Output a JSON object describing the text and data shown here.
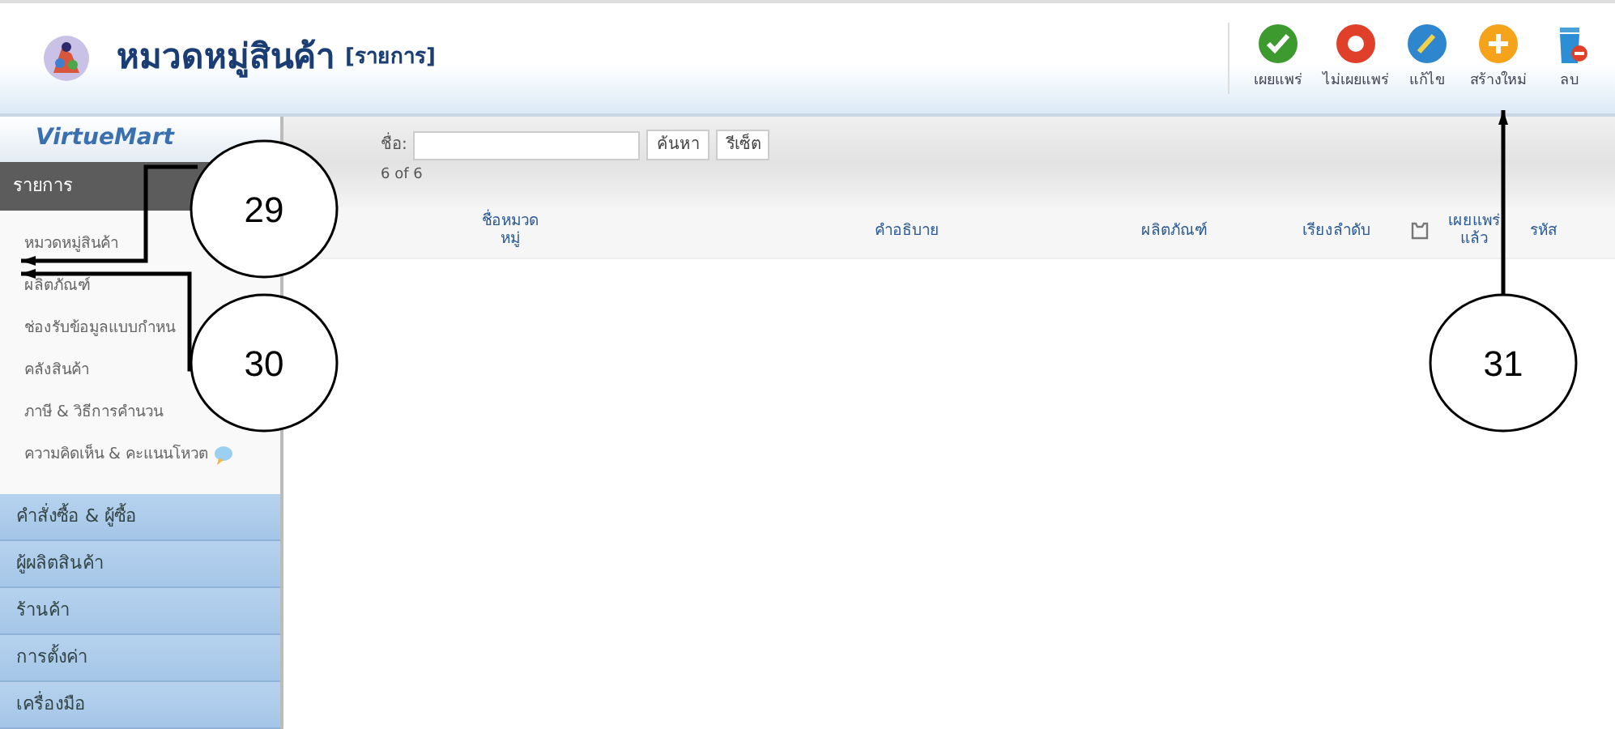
{
  "header": {
    "title": "หมวดหมู่สินค้า",
    "subtitle": "[รายการ]"
  },
  "toolbar": [
    {
      "kind": "publish",
      "label": "เผยแพร่"
    },
    {
      "kind": "unpublish",
      "label": "ไม่เผยแพร่"
    },
    {
      "kind": "edit",
      "label": "แก้ไข"
    },
    {
      "kind": "new",
      "label": "สร้างใหม่"
    },
    {
      "kind": "delete",
      "label": "ลบ"
    }
  ],
  "sidebar": {
    "logo": "VirtueMart",
    "section": "รายการ",
    "items": [
      {
        "label": "หมวดหมู่สินค้า",
        "icon": false
      },
      {
        "label": "ผลิตภัณฑ์",
        "icon": false
      },
      {
        "label": "ช่องรับข้อมูลแบบกำหน",
        "icon": false
      },
      {
        "label": "คลังสินค้า",
        "icon": false
      },
      {
        "label": "ภาษี & วิธีการคำนวน",
        "icon": false
      },
      {
        "label": "ความคิดเห็น & คะแนนโหวต",
        "icon": true
      }
    ],
    "groups": [
      "คำสั่งซื้อ & ผู้ซื้อ",
      "ผู้ผลิตสินค้า",
      "ร้านค้า",
      "การตั้งค่า",
      "เครื่องมือ"
    ]
  },
  "filter": {
    "label": "ชื่อ:",
    "buttons": [
      "ค้นหา",
      "รีเซ็ต"
    ],
    "count": "6 of 6"
  },
  "table": {
    "columns": [
      {
        "kind": "text",
        "label": "ชื่อหมวดหมู่"
      },
      {
        "kind": "text",
        "label": "คำอธิบาย"
      },
      {
        "kind": "text",
        "label": "ผลิตภัณฑ์"
      },
      {
        "kind": "text",
        "label": "เรียงลำดับ"
      },
      {
        "kind": "icon"
      },
      {
        "kind": "text",
        "label": "เผยแพร่แล้ว"
      },
      {
        "kind": "text",
        "label": "รหัส"
      }
    ]
  },
  "callouts": [
    {
      "number": "29"
    },
    {
      "number": "30"
    },
    {
      "number": "31"
    }
  ]
}
